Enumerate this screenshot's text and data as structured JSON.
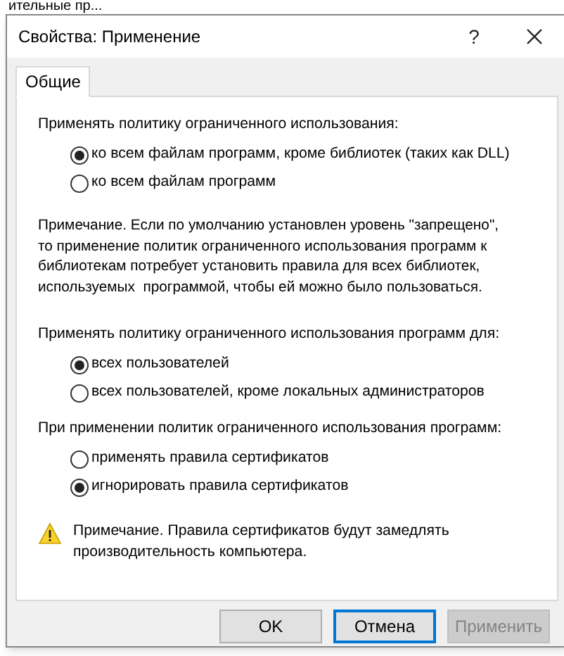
{
  "background_window": {
    "text": "ительные пр..."
  },
  "window": {
    "title": "Свойства: Применение",
    "help": "?"
  },
  "tabs": [
    {
      "label": "Общие",
      "selected": true
    }
  ],
  "sections": [
    {
      "kind": "radio_group",
      "heading": "Применять политику ограниченного использования:",
      "options": [
        {
          "label": "ко всем файлам программ, кроме библиотек (таких как DLL)",
          "selected": true
        },
        {
          "label": "ко всем файлам программ",
          "selected": false
        }
      ]
    },
    {
      "kind": "note",
      "text": "Примечание. Если по умолчанию установлен уровень \"запрещено\",\nто применение политик ограниченного использования программ к\nбиблиотекам потребует установить правила для всех библиотек,\nиспользуемых  программой, чтобы ей можно было пользоваться."
    },
    {
      "kind": "radio_group",
      "heading": "Применять политику ограниченного использования программ для:",
      "options": [
        {
          "label": "всех пользователей",
          "selected": true
        },
        {
          "label": "всех пользователей, кроме локальных администраторов",
          "selected": false
        }
      ]
    },
    {
      "kind": "radio_group",
      "heading": "При применении политик ограниченного использования программ:",
      "options": [
        {
          "label": "применять правила сертификатов",
          "selected": false
        },
        {
          "label": "игнорировать правила сертификатов",
          "selected": true
        }
      ]
    },
    {
      "kind": "warning",
      "text": "Примечание. Правила сертификатов будут замедлять\nпроизводительность компьютера."
    }
  ],
  "buttons": [
    {
      "label": "OK",
      "default": false,
      "disabled": false
    },
    {
      "label": "Отмена",
      "default": true,
      "disabled": false
    },
    {
      "label": "Применить",
      "default": false,
      "disabled": true
    }
  ]
}
